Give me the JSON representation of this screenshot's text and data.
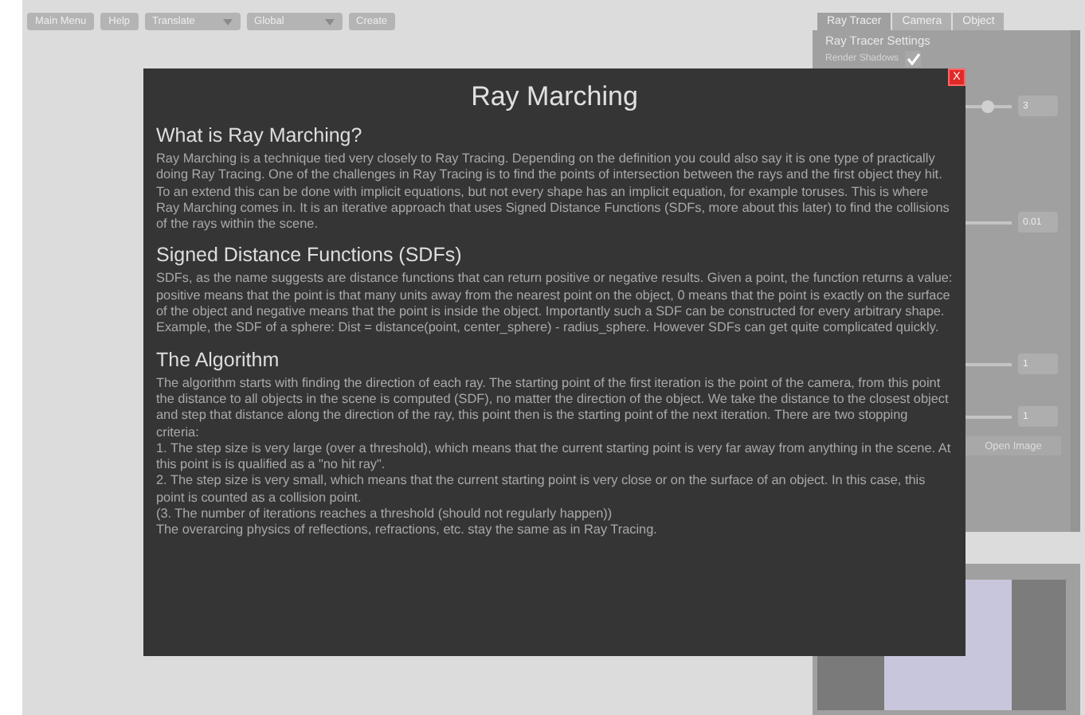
{
  "toolbar": {
    "buttons": [
      {
        "label": "Main Menu",
        "kind": "button"
      },
      {
        "label": "Help",
        "kind": "button"
      },
      {
        "label": "Translate",
        "kind": "dropdown"
      },
      {
        "label": "Global",
        "kind": "dropdown"
      },
      {
        "label": "Create",
        "kind": "button"
      }
    ]
  },
  "panel": {
    "tabs": [
      {
        "label": "Ray Tracer",
        "selected": true
      },
      {
        "label": "Camera",
        "selected": false
      },
      {
        "label": "Object",
        "selected": false
      }
    ],
    "heading": "Ray Tracer Settings",
    "checkbox": {
      "label": "Render Shadows",
      "checked": true
    },
    "sliders": [
      {
        "value": "3",
        "level": 0.5
      },
      {
        "value": "0.01"
      },
      {
        "value": "1"
      },
      {
        "value": "1"
      }
    ],
    "open_button": "Open Image"
  },
  "modal": {
    "title": "Ray Marching",
    "close": "X",
    "sections": [
      {
        "heading": "What is Ray Marching?",
        "paragraphs": [
          "Ray Marching is a technique tied very closely to Ray Tracing. Depending on the definition you could also say it is one type of practically doing Ray Tracing. One of the challenges in Ray Tracing is to find the points of intersection between the rays and the first object they hit. To an extend this can be done with implicit equations, but not every shape has an implicit equation, for example toruses. This is where Ray Marching comes in. It is an iterative approach that uses Signed Distance Functions (SDFs, more about this later) to find the collisions of the rays within the scene."
        ]
      },
      {
        "heading": "Signed Distance Functions (SDFs)",
        "paragraphs": [
          "SDFs, as the name suggests are distance functions that can return positive or negative results. Given a point, the function returns a value: positive means that the point is that many units away from the nearest point on the object, 0 means that the point is exactly on the surface of the object and negative means that the point is inside the object. Importantly such a SDF can be constructed for every arbitrary shape.",
          "Example, the SDF of a sphere: Dist = distance(point, center_sphere) - radius_sphere. However SDFs can get quite complicated quickly."
        ]
      },
      {
        "heading": "The Algorithm",
        "paragraphs": [
          "The algorithm starts with finding the direction of each ray. The starting point of the first iteration is the point of the camera, from this point the distance to all objects in the scene is computed (SDF), no matter the direction of the object. We take the distance to the closest object and step that distance along the direction of the ray, this point then is the starting point of the next iteration. There are two stopping criteria:",
          "1. The step size is very large (over a threshold), which means that the current starting point is very far away from anything in the scene. At this point is is qualified as a \"no hit ray\".",
          "2. The step size is very small, which means that the current starting point is very close or on the surface of an object. In this case, this point is counted as a collision point.",
          "(3. The number of iterations reaches a threshold (should not regularly happen))",
          "The overarcing physics of reflections, refractions, etc. stay the same as in Ray Tracing."
        ]
      }
    ]
  }
}
